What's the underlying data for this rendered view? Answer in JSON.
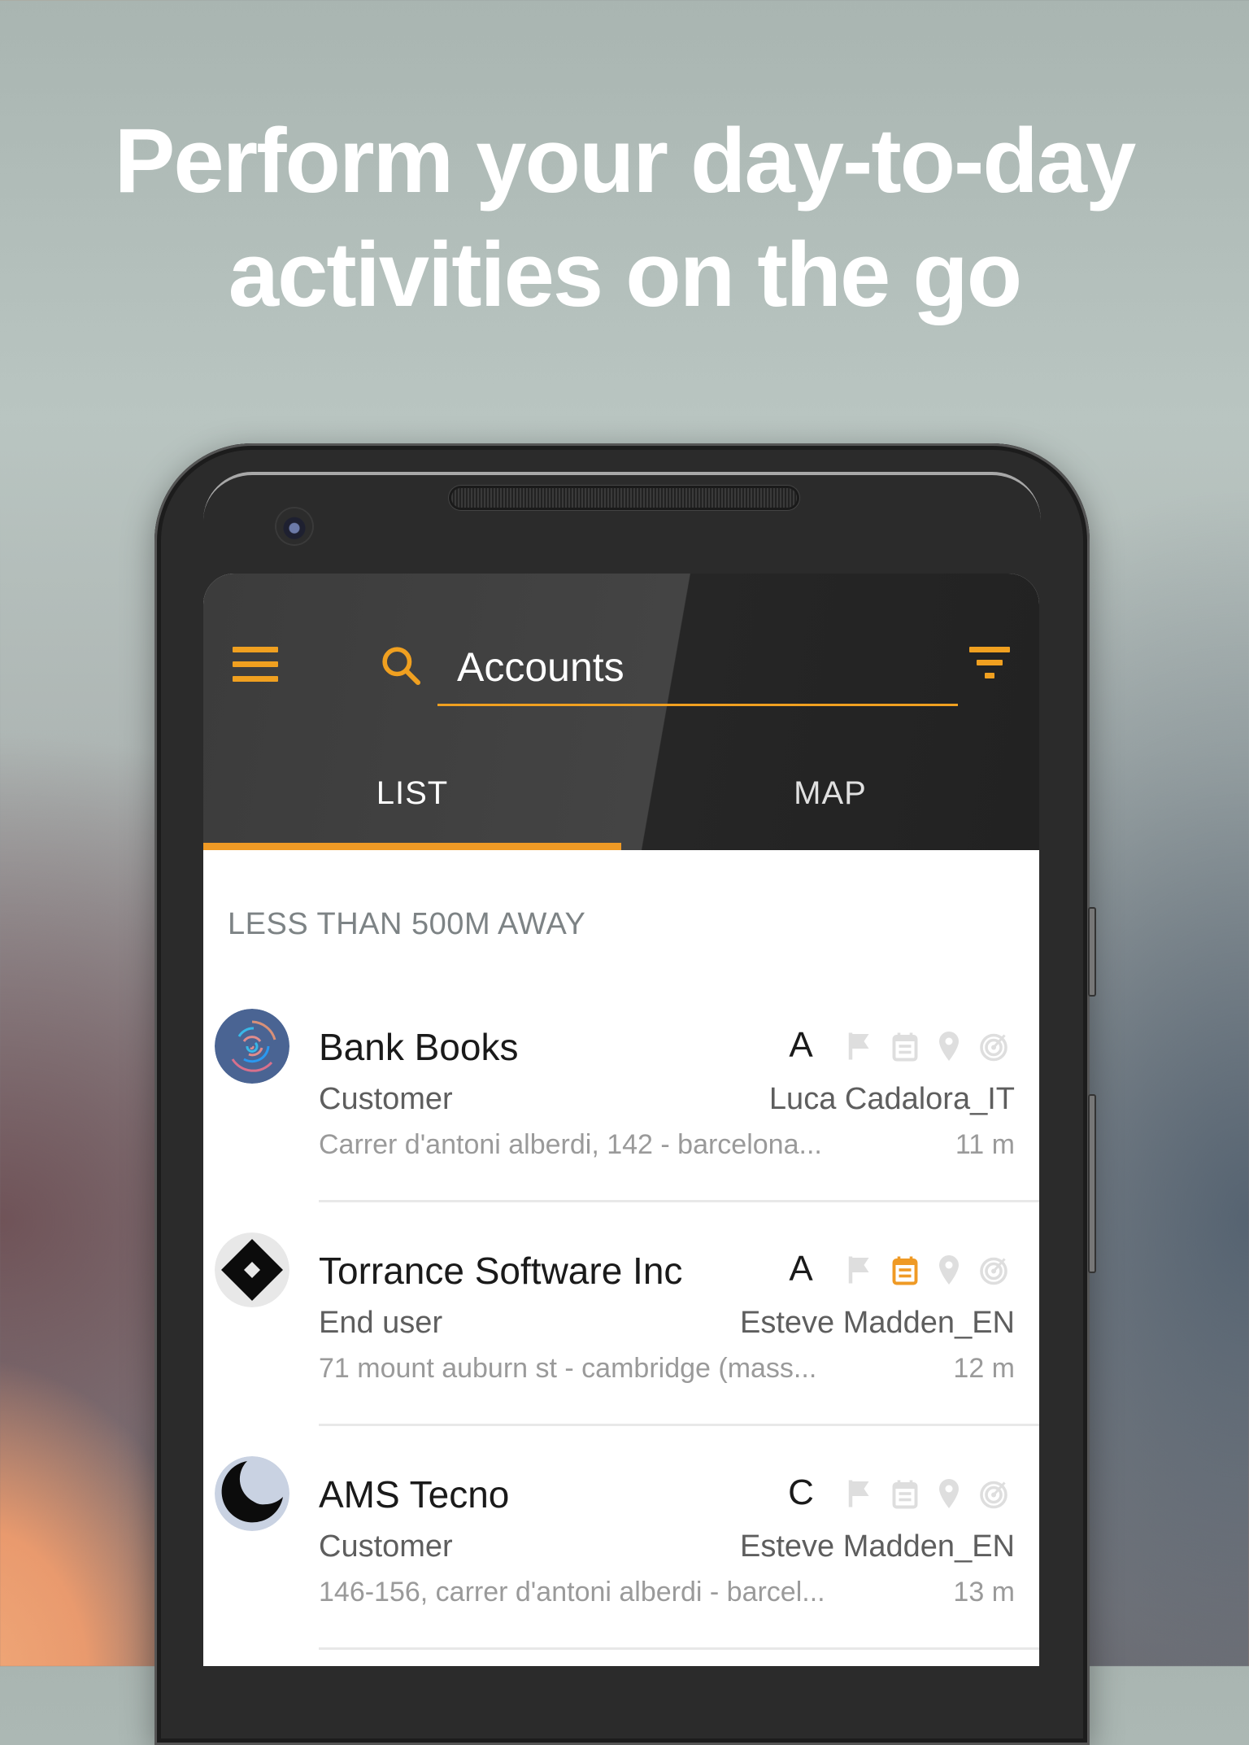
{
  "headline": {
    "line1": "Perform your day-to-day",
    "line2": "activities on the go"
  },
  "appbar": {
    "search_value": "Accounts",
    "menu_icon": "hamburger-menu-icon",
    "search_icon": "search-icon",
    "filter_icon": "filter-icon",
    "accent_color": "#f0a020"
  },
  "tabs": [
    {
      "label": "LIST",
      "active": true
    },
    {
      "label": "MAP",
      "active": false
    }
  ],
  "section": {
    "label": "LESS THAN 500M AWAY"
  },
  "accounts": [
    {
      "name": "Bank Books",
      "rating": "A",
      "type": "Customer",
      "owner": "Luca Cadalora_IT",
      "address": "Carrer d'antoni alberdi,  142 - barcelona...",
      "distance": "11 m",
      "avatar": "bank-books-logo",
      "actions": {
        "flag": false,
        "calendar": false,
        "location": false,
        "target": false
      }
    },
    {
      "name": "Torrance Software Inc",
      "rating": "A",
      "type": "End user",
      "owner": "Esteve Madden_EN",
      "address": "71 mount auburn st - cambridge (mass...",
      "distance": "12 m",
      "avatar": "torrance-software-logo",
      "actions": {
        "flag": false,
        "calendar": true,
        "location": false,
        "target": false
      }
    },
    {
      "name": "AMS Tecno",
      "rating": "C",
      "type": "Customer",
      "owner": "Esteve Madden_EN",
      "address": "146-156, carrer d'antoni alberdi - barcel...",
      "distance": "13 m",
      "avatar": "ams-tecno-logo",
      "actions": {
        "flag": false,
        "calendar": false,
        "location": false,
        "target": false
      }
    }
  ],
  "colors": {
    "active_icon": "#ef9a25",
    "inactive_icon": "#dedede"
  }
}
